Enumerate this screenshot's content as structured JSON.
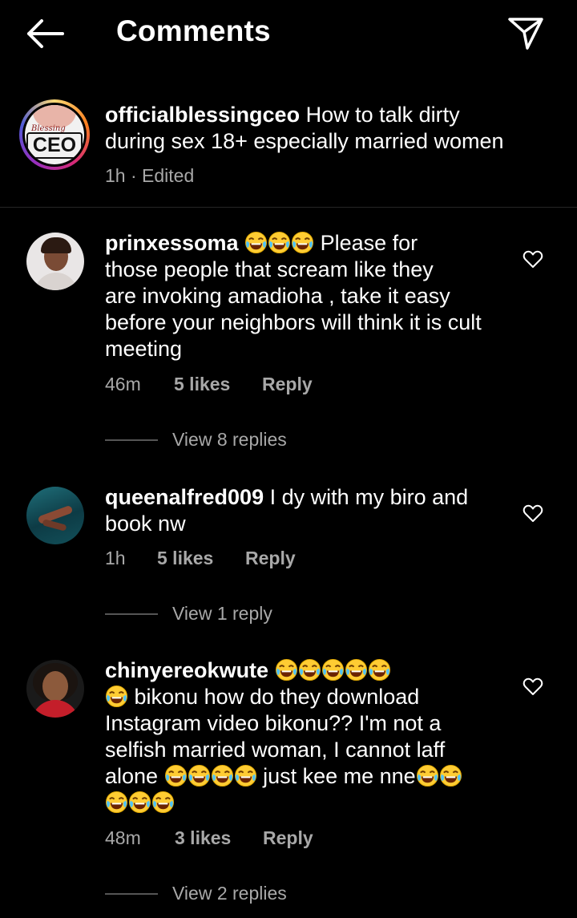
{
  "header": {
    "title": "Comments",
    "back_icon": "arrow-left-icon",
    "share_icon": "paper-plane-icon"
  },
  "post": {
    "username": "officialblessingceo",
    "caption_line1": " How to talk dirty",
    "caption_line2": "during sex 18+ especially married women",
    "time": "1h · Edited",
    "avatar_text_top": "Blessing",
    "avatar_text_main": "CEO"
  },
  "comments": [
    {
      "username": "prinxessoma",
      "line1_text": " Please for",
      "line2": "those people that scream like they",
      "line3": "are invoking amadioha , take it easy",
      "line4": "before your neighbors will think it is cult",
      "line5": "meeting",
      "time": "46m",
      "likes": "5 likes",
      "reply": "Reply",
      "view_replies": "View 8 replies"
    },
    {
      "username": "queenalfred009",
      "line1_text": " I dy with my biro and",
      "line2": "book nw",
      "time": "1h",
      "likes": "5 likes",
      "reply": "Reply",
      "view_replies": "View 1 reply"
    },
    {
      "username": "chinyereokwute",
      "line2_text": " bikonu how do they download",
      "line3": "Instagram video bikonu?? I'm not a",
      "line4": "selfish married woman, I cannot laff",
      "line5_a": "alone ",
      "line5_b": " just kee me nne",
      "time": "48m",
      "likes": "3 likes",
      "reply": "Reply",
      "view_replies": "View 2 replies"
    }
  ],
  "colors": {
    "background": "#000000",
    "text": "#ffffff",
    "secondary": "#a8a8a8"
  }
}
